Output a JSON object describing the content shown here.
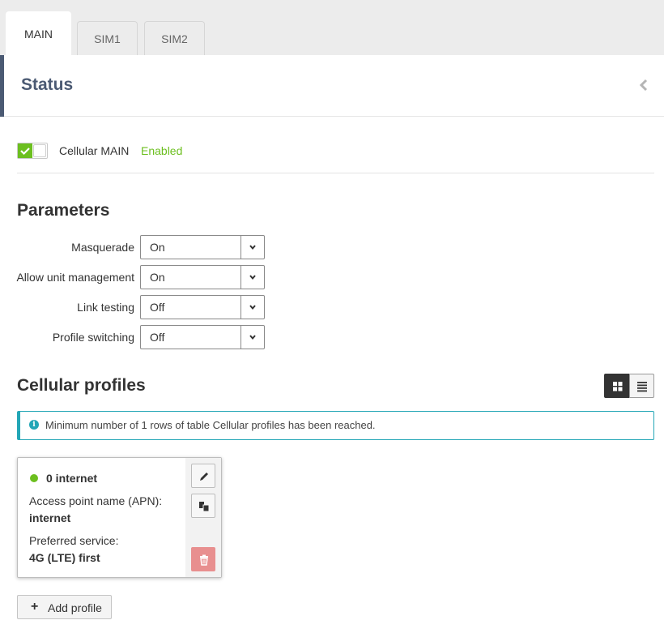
{
  "tabs": [
    {
      "label": "MAIN",
      "active": true
    },
    {
      "label": "SIM1",
      "active": false
    },
    {
      "label": "SIM2",
      "active": false
    }
  ],
  "status": {
    "title": "Status",
    "cellular_label": "Cellular MAIN",
    "cellular_state": "Enabled",
    "enabled": true
  },
  "parameters": {
    "title": "Parameters",
    "rows": [
      {
        "label": "Masquerade",
        "value": "On"
      },
      {
        "label": "Allow unit management",
        "value": "On"
      },
      {
        "label": "Link testing",
        "value": "Off"
      },
      {
        "label": "Profile switching",
        "value": "Off"
      }
    ]
  },
  "profiles": {
    "title": "Cellular profiles",
    "notice": "Minimum number of 1 rows of table Cellular profiles has been reached.",
    "cards": [
      {
        "name": "0 internet",
        "apn_label": "Access point name (APN):",
        "apn_value": "internet",
        "service_label": "Preferred service:",
        "service_value": "4G (LTE) first"
      }
    ],
    "add_label": "Add profile"
  },
  "colors": {
    "accent_green": "#6cbf1f",
    "header_blue": "#4b5a73",
    "info_teal": "#23a6b6",
    "delete_red": "#e88f8f"
  }
}
